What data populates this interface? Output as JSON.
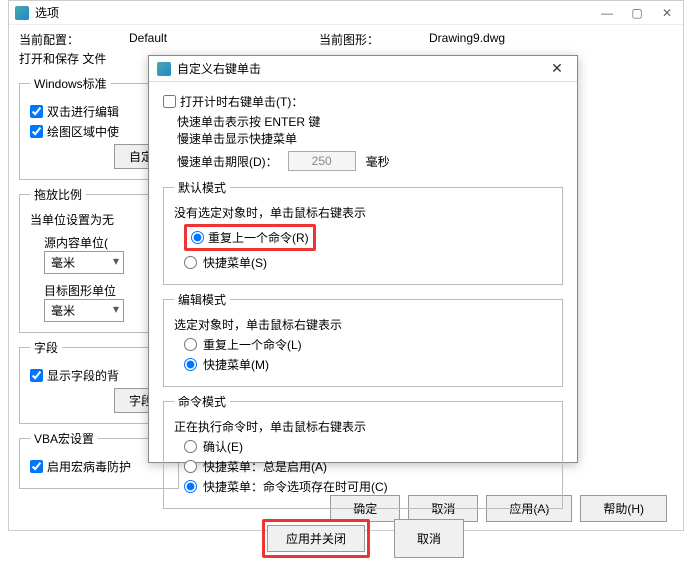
{
  "main": {
    "title": "选项",
    "config_lbl": "当前配置：",
    "config_val": "Default",
    "drawing_lbl": "当前图形：",
    "drawing_val": "Drawing9.dwg",
    "tabs": "打开和保存 文件",
    "btn_ok": "确定",
    "btn_cancel": "取消",
    "btn_apply": "应用(A)",
    "btn_help": "帮助(H)"
  },
  "left": {
    "grp_win": "Windows标准",
    "cb_dblclick": "双击进行编辑",
    "cb_region": "绘图区域中使",
    "btn_custom": "自定",
    "grp_scale": "拖放比例",
    "scale_desc": "当单位设置为无",
    "src_unit_lbl": "源内容单位(",
    "dst_unit_lbl": "目标图形单位",
    "unit_mm": "毫米",
    "grp_field": "字段",
    "cb_showfield": "显示字段的背",
    "btn_field": "字段",
    "grp_vba": "VBA宏设置",
    "cb_virus": "启用宏病毒防护"
  },
  "dlg": {
    "title": "自定义右键单击",
    "cb_timer": "打开计时右键单击(T)：",
    "fast_note": "快速单击表示按 ENTER 键",
    "slow_note": "慢速单击显示快捷菜单",
    "slow_lbl": "慢速单击期限(D)：",
    "slow_val": "250",
    "slow_ms": "毫秒",
    "grp_default": "默认模式",
    "default_desc": "没有选定对象时，单击鼠标右键表示",
    "r_repeat_r": "重复上一个命令(R)",
    "r_menu_s": "快捷菜单(S)",
    "grp_edit": "编辑模式",
    "edit_desc": "选定对象时，单击鼠标右键表示",
    "r_repeat_l": "重复上一个命令(L)",
    "r_menu_m": "快捷菜单(M)",
    "grp_cmd": "命令模式",
    "cmd_desc": "正在执行命令时，单击鼠标右键表示",
    "r_confirm": "确认(E)",
    "r_menu_always": "快捷菜单：总是启用(A)",
    "r_menu_opt": "快捷菜单：命令选项存在时可用(C)",
    "btn_apply_close": "应用并关闭",
    "btn_cancel": "取消"
  }
}
